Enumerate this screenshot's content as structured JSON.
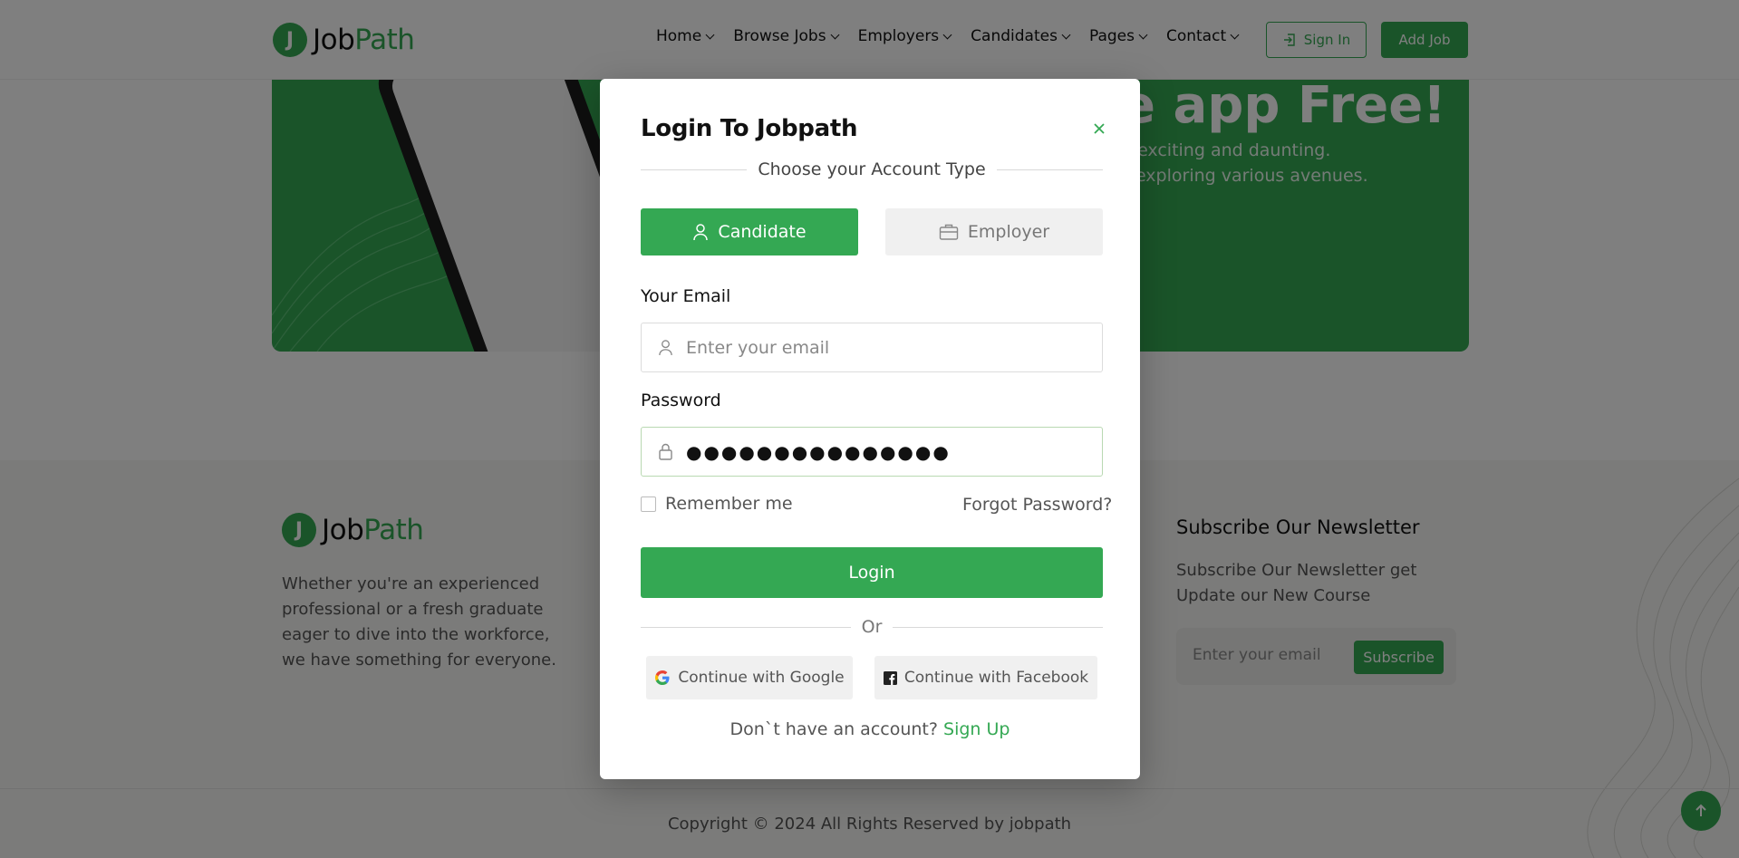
{
  "colors": {
    "accent": "#34a853",
    "overlay": "rgba(0,0,0,0.5)"
  },
  "header": {
    "logo": {
      "letter": "J",
      "name_part1": "Job",
      "name_part2": "Path"
    },
    "nav": [
      {
        "label": "Home",
        "icon": "chevron-down-icon"
      },
      {
        "label": "Browse Jobs",
        "icon": "chevron-down-icon"
      },
      {
        "label": "Employers",
        "icon": "chevron-down-icon"
      },
      {
        "label": "Candidates",
        "icon": "chevron-down-icon"
      },
      {
        "label": "Pages",
        "icon": "chevron-down-icon"
      },
      {
        "label": "Contact",
        "icon": "chevron-down-icon"
      }
    ],
    "sign_in": {
      "label": "Sign In",
      "icon": "login-icon"
    },
    "add_job": "Add Job"
  },
  "promo": {
    "title_fragment": "e app Free!",
    "text_line1": "n exciting and daunting.",
    "text_line2": "s exploring various avenues."
  },
  "footer": {
    "logo": {
      "letter": "J",
      "name_part1": "Job",
      "name_part2": "Path"
    },
    "description": "Whether you're an experienced professional or a fresh graduate eager to dive into the workforce, we have something for everyone.",
    "newsletter": {
      "title": "Subscribe Our Newsletter",
      "description": "Subscribe Our Newsletter get Update our New Course",
      "placeholder": "Enter your email",
      "button": "Subscribe"
    },
    "copyright": "Copyright © 2024 All Rights Reserved by jobpath",
    "back_to_top_icon": "arrow-up-icon"
  },
  "modal": {
    "title": "Login To Jobpath",
    "close_icon": "close-icon",
    "subtitle": "Choose your Account Type",
    "account_types": [
      {
        "label": "Candidate",
        "icon": "user-icon",
        "selected": true
      },
      {
        "label": "Employer",
        "icon": "briefcase-icon",
        "selected": false
      }
    ],
    "email": {
      "label": "Your Email",
      "placeholder": "Enter your email",
      "icon": "user-icon"
    },
    "password": {
      "label": "Password",
      "value": "●●●●●●●●●●●●●●●",
      "icon": "lock-icon"
    },
    "remember_me": "Remember me",
    "forgot_password": "Forgot Password?",
    "login_button": "Login",
    "or_text": "Or",
    "google_button": "Continue with Google",
    "facebook_button": "Continue with Facebook",
    "signup_prompt": "Don`t have an account?",
    "signup_link": "Sign Up"
  }
}
